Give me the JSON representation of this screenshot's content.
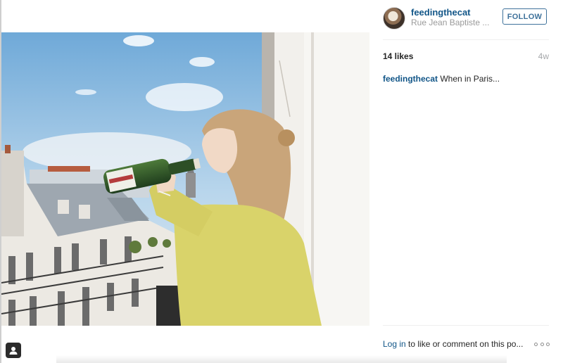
{
  "post": {
    "username": "feedingthecat",
    "location": "Rue Jean Baptiste ...",
    "follow_label": "FOLLOW",
    "likes": "14 likes",
    "age": "4w",
    "caption_user": "feedingthecat",
    "caption_text": "When in Paris..."
  },
  "footer": {
    "login_link": "Log in",
    "rest": " to like or comment on this po..."
  },
  "icons": {
    "user_tag": "user-tag-icon",
    "more": "more-options-icon"
  },
  "colors": {
    "link": "#125688",
    "follow_border": "#3f729b",
    "muted": "#9a9a9a"
  }
}
